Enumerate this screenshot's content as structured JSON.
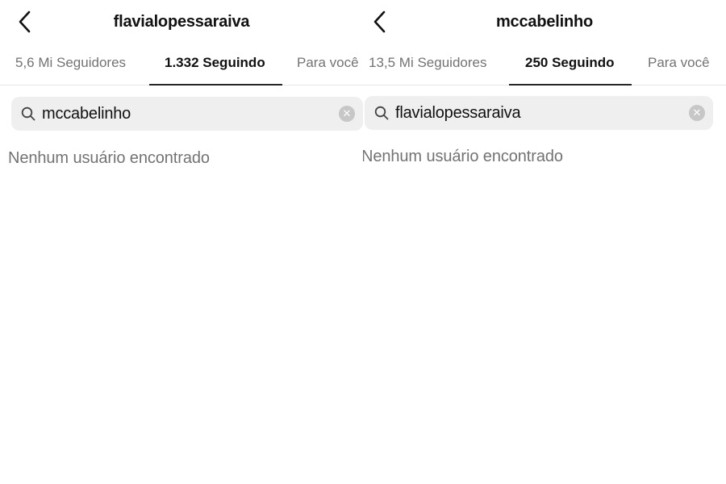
{
  "panels": [
    {
      "header": {
        "title": "flavialopessaraiva"
      },
      "tabs": [
        {
          "label": "5,6 Mi Seguidores"
        },
        {
          "label": "1.332 Seguindo",
          "active": true
        },
        {
          "label": "Para você"
        }
      ],
      "search": {
        "value": "mccabelinho"
      },
      "empty_message": "Nenhum usuário encontrado"
    },
    {
      "header": {
        "title": "mccabelinho"
      },
      "tabs": [
        {
          "label": "13,5 Mi Seguidores"
        },
        {
          "label": "250 Seguindo",
          "active": true
        },
        {
          "label": "Para você"
        }
      ],
      "search": {
        "value": "flavialopessaraiva"
      },
      "empty_message": "Nenhum usuário encontrado"
    }
  ],
  "icons": {
    "back": "chevron-left-icon",
    "search": "magnifier-icon",
    "clear": "clear-circle-icon"
  }
}
